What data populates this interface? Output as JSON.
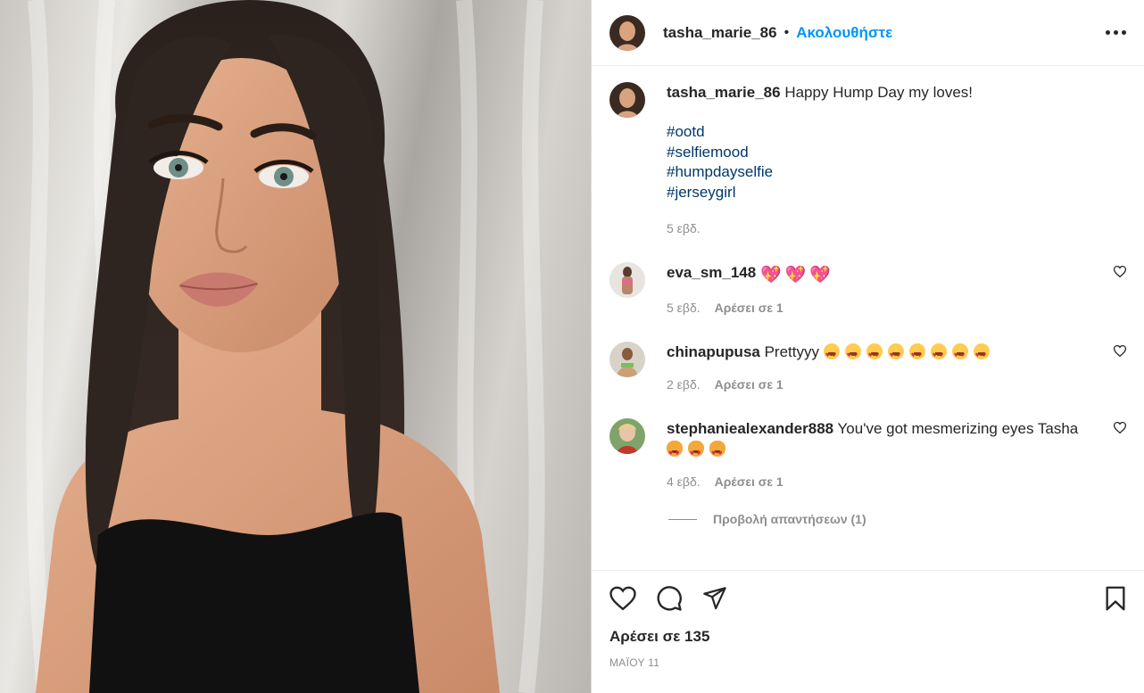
{
  "post": {
    "author": "tasha_marie_86",
    "separator": "•",
    "follow_label": "Ακολουθήστε",
    "more_icon": "more-horizontal-icon"
  },
  "caption": {
    "user": "tasha_marie_86",
    "text": "Happy Hump Day my loves!",
    "hashtags": [
      "#ootd",
      "#selfiemood",
      "#humpdayselfie",
      "#jerseygirl"
    ],
    "time": "5 εβδ."
  },
  "comments": [
    {
      "user": "eva_sm_148",
      "text": "",
      "emoji": [
        "💖",
        "💖",
        "💖"
      ],
      "time": "5 εβδ.",
      "likes": "Αρέσει σε 1"
    },
    {
      "user": "chinapupusa",
      "text": "Prettyyy",
      "emoji": [
        "😍",
        "😍",
        "😍",
        "😍",
        "😍",
        "😍",
        "😍",
        "😍"
      ],
      "time": "2 εβδ.",
      "likes": "Αρέσει σε 1"
    },
    {
      "user": "stephaniealexander888",
      "text": "You've got mesmerizing eyes Tasha",
      "emoji": [
        "😻",
        "😻",
        "😻"
      ],
      "time": "4 εβδ.",
      "likes": "Αρέσει σε 1"
    }
  ],
  "view_replies": "Προβολή απαντήσεων (1)",
  "actions": {
    "icons": [
      "heart-icon",
      "comment-icon",
      "share-icon",
      "bookmark-icon"
    ]
  },
  "likes_total": "Αρέσει σε 135",
  "date": "ΜΑΪΟΥ 11"
}
